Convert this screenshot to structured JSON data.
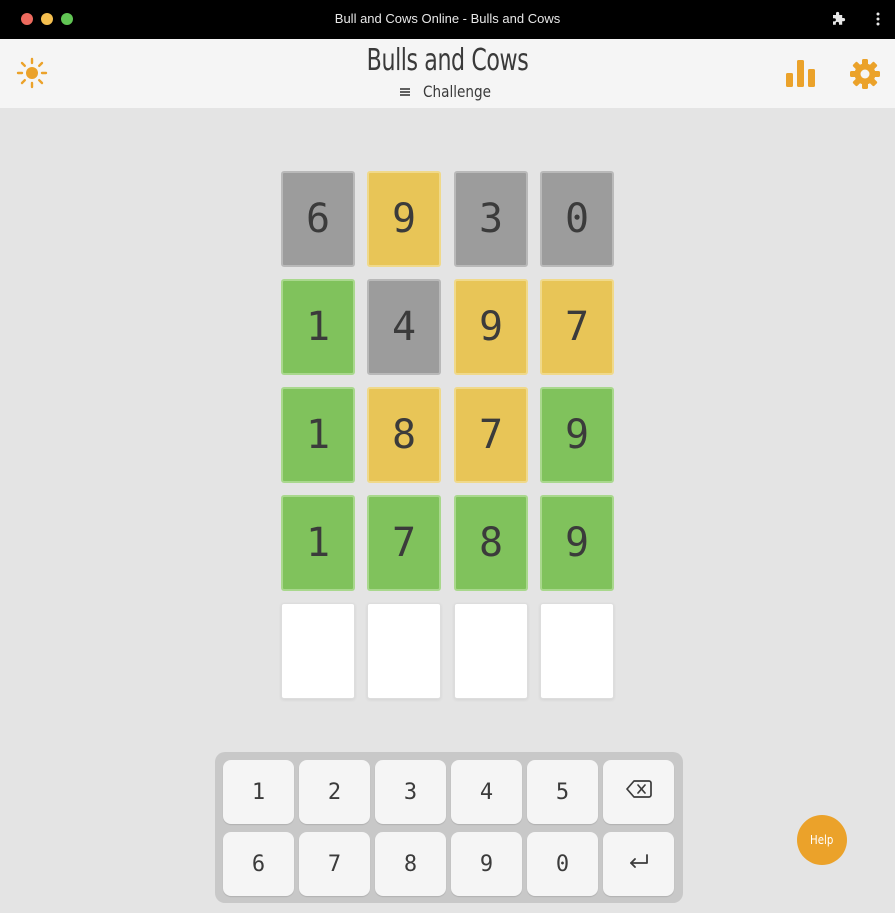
{
  "window": {
    "title": "Bull and Cows Online - Bulls and Cows"
  },
  "header": {
    "title": "Bulls and Cows",
    "mode": "Challenge"
  },
  "colors": {
    "accent": "#eba22a",
    "gray": "#9c9c9c",
    "yellow": "#e8c557",
    "green": "#80c25c"
  },
  "board": {
    "rows": [
      [
        {
          "digit": "6",
          "state": "gray"
        },
        {
          "digit": "9",
          "state": "yellow"
        },
        {
          "digit": "3",
          "state": "gray"
        },
        {
          "digit": "0",
          "state": "gray"
        }
      ],
      [
        {
          "digit": "1",
          "state": "green"
        },
        {
          "digit": "4",
          "state": "gray"
        },
        {
          "digit": "9",
          "state": "yellow"
        },
        {
          "digit": "7",
          "state": "yellow"
        }
      ],
      [
        {
          "digit": "1",
          "state": "green"
        },
        {
          "digit": "8",
          "state": "yellow"
        },
        {
          "digit": "7",
          "state": "yellow"
        },
        {
          "digit": "9",
          "state": "green"
        }
      ],
      [
        {
          "digit": "1",
          "state": "green"
        },
        {
          "digit": "7",
          "state": "green"
        },
        {
          "digit": "8",
          "state": "green"
        },
        {
          "digit": "9",
          "state": "green"
        }
      ],
      [
        {
          "digit": "",
          "state": "empty"
        },
        {
          "digit": "",
          "state": "empty"
        },
        {
          "digit": "",
          "state": "empty"
        },
        {
          "digit": "",
          "state": "empty"
        }
      ]
    ]
  },
  "keyboard": {
    "row1": [
      "1",
      "2",
      "3",
      "4",
      "5"
    ],
    "row2": [
      "6",
      "7",
      "8",
      "9",
      "0"
    ],
    "backspace_icon": "backspace-icon",
    "enter_icon": "enter-icon"
  },
  "help": {
    "label": "Help"
  }
}
